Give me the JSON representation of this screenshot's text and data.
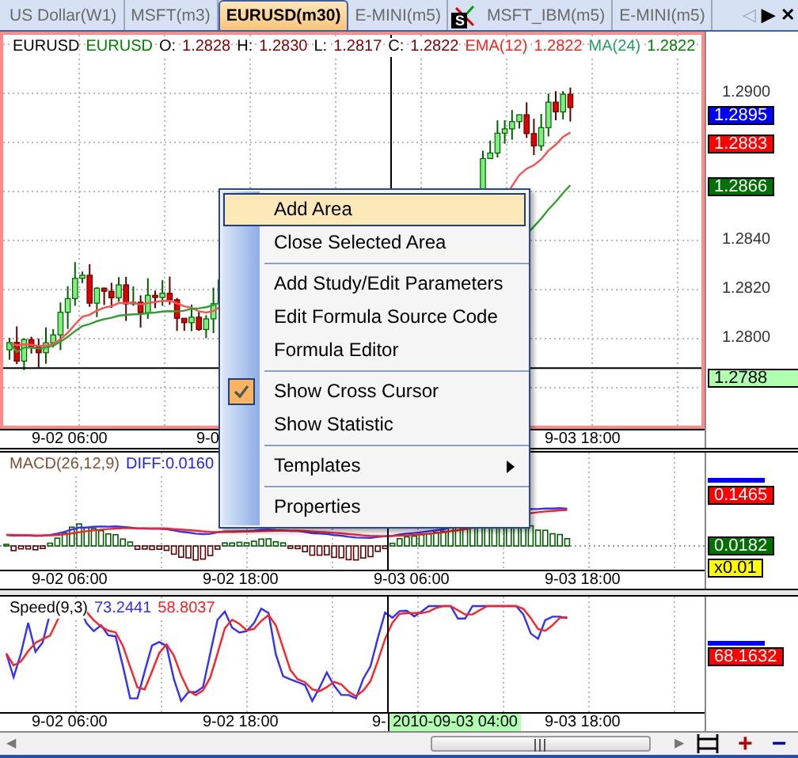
{
  "tabs": [
    {
      "label": "US Dollar(W1)",
      "selected": false,
      "kind": "plain"
    },
    {
      "label": "MSFT(m3)",
      "selected": false,
      "kind": "plain"
    },
    {
      "label": "EURUSD(m30)",
      "selected": true,
      "kind": "plain"
    },
    {
      "label": "E-MINI(m5)",
      "selected": false,
      "kind": "plain"
    },
    {
      "label": "MSFT_IBM(m5)",
      "selected": false,
      "kind": "spread",
      "badge": "S"
    },
    {
      "label": "E-MINI(m5)",
      "selected": false,
      "kind": "plain"
    }
  ],
  "tab_controls": [
    {
      "symbol": "◁",
      "disabled": true
    },
    {
      "symbol": "▶",
      "disabled": false
    },
    {
      "symbol": "✕",
      "disabled": false
    }
  ],
  "main_panel": {
    "header": [
      {
        "text": "EURUSD",
        "color": "#000000"
      },
      {
        "text": "EURUSD",
        "color": "#008000"
      },
      {
        "text": "O:",
        "color": "#000000"
      },
      {
        "text": "1.2828",
        "color": "#800000"
      },
      {
        "text": "H:",
        "color": "#000000"
      },
      {
        "text": "1.2830",
        "color": "#800000"
      },
      {
        "text": "L:",
        "color": "#000000"
      },
      {
        "text": "1.2817",
        "color": "#800000"
      },
      {
        "text": "C:",
        "color": "#000000"
      },
      {
        "text": "1.2822",
        "color": "#800000"
      },
      {
        "text": "EMA(12)",
        "color": "#ff2020"
      },
      {
        "text": "1.2822",
        "color": "#ff2020"
      },
      {
        "text": "MA(24)",
        "color": "#20a060"
      },
      {
        "text": "1.2822",
        "color": "#008000"
      }
    ],
    "y_ticks": [
      "1.2900",
      "1.2840",
      "1.2820",
      "1.2800"
    ],
    "value_tags": [
      {
        "text": "1.2895",
        "color": "#0000ff"
      },
      {
        "text": "1.2883",
        "color": "#ff0000"
      },
      {
        "text": "1.2866",
        "color": "#007000"
      }
    ],
    "cursor_tag": "1.2788",
    "time_labels": [
      "9-02 06:00",
      "9-0",
      "9-03 18:00"
    ]
  },
  "macd_panel": {
    "header": [
      {
        "text": "MACD(26,12,9)",
        "color": "#805030"
      },
      {
        "text": "DIFF:0.0160",
        "color": "#2020ff"
      }
    ],
    "value_tags": [
      {
        "text": "0.1465",
        "color": "#ff0000"
      },
      {
        "text": "0.0182",
        "color": "#007000"
      },
      {
        "text": "x0.01",
        "color": "#ffff00"
      }
    ],
    "time_labels": [
      "9-02 06:00",
      "9-02 18:00",
      "9-03 06:00",
      "9-03 18:00"
    ]
  },
  "speed_panel": {
    "header": [
      {
        "text": "Speed(9,3)",
        "color": "#000000"
      },
      {
        "text": "73.2441",
        "color": "#3030ff"
      },
      {
        "text": "58.8037",
        "color": "#ff2020"
      }
    ],
    "value_tags": [
      {
        "text": "68.1632",
        "color": "#ff0000"
      }
    ],
    "time_labels": [
      "9-02 06:00",
      "9-02 18:00",
      "9-",
      "9-03 18:00"
    ],
    "cursor_time": "2010-09-03 04:00"
  },
  "context_menu": {
    "items": [
      {
        "kind": "item",
        "label": "Add Area",
        "highlighted": true,
        "checked": false,
        "submenu": false
      },
      {
        "kind": "item",
        "label": "Close Selected Area",
        "highlighted": false,
        "checked": false,
        "submenu": false
      },
      {
        "kind": "separator"
      },
      {
        "kind": "item",
        "label": "Add Study/Edit Parameters",
        "highlighted": false,
        "checked": false,
        "submenu": false
      },
      {
        "kind": "item",
        "label": "Edit Formula Source Code",
        "highlighted": false,
        "checked": false,
        "submenu": false
      },
      {
        "kind": "item",
        "label": "Formula Editor",
        "highlighted": false,
        "checked": false,
        "submenu": false
      },
      {
        "kind": "separator"
      },
      {
        "kind": "item",
        "label": "Show Cross Cursor",
        "highlighted": false,
        "checked": true,
        "submenu": false
      },
      {
        "kind": "item",
        "label": "Show Statistic",
        "highlighted": false,
        "checked": false,
        "submenu": false
      },
      {
        "kind": "separator"
      },
      {
        "kind": "item",
        "label": "Templates",
        "highlighted": false,
        "checked": false,
        "submenu": true
      },
      {
        "kind": "separator"
      },
      {
        "kind": "item",
        "label": "Properties",
        "highlighted": false,
        "checked": false,
        "submenu": false
      }
    ]
  },
  "scrollbar": {
    "left_arrow": "◀",
    "right_arrow": "▶"
  },
  "zoom_buttons": [
    {
      "symbol": "+",
      "color": "#c00000"
    },
    {
      "symbol": "−",
      "color": "#0000c0"
    }
  ]
}
